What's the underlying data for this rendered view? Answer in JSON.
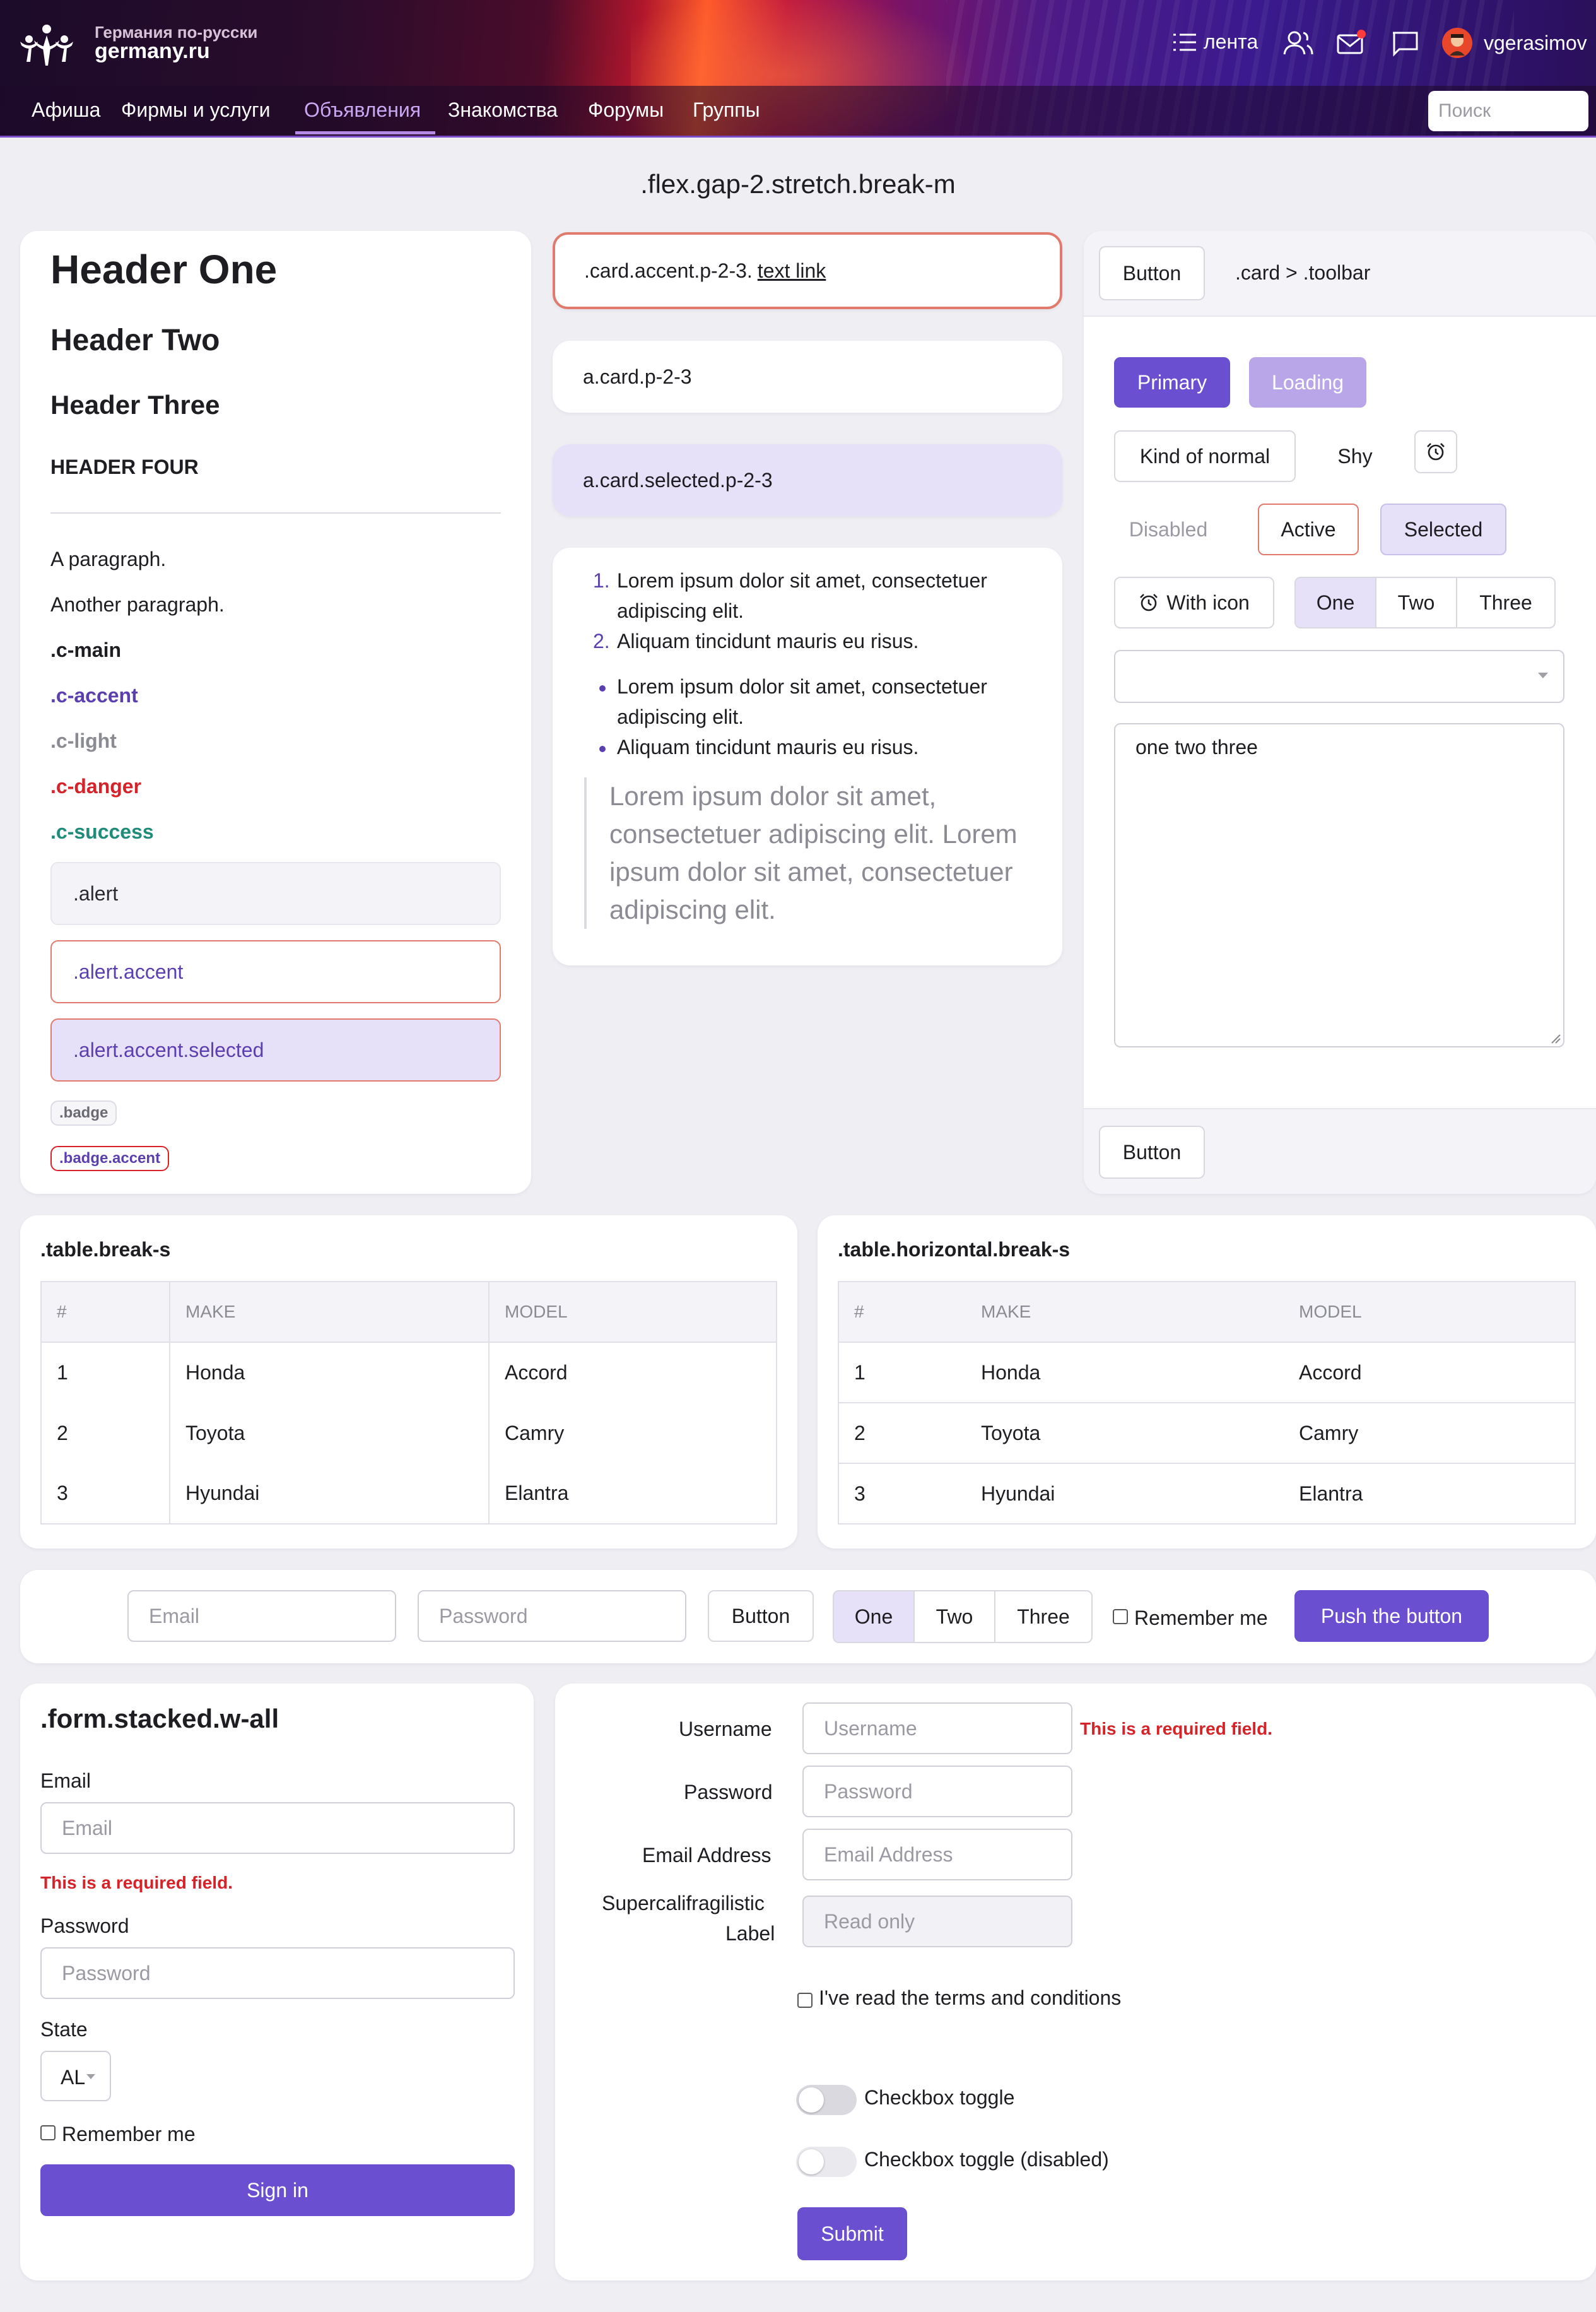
{
  "header": {
    "logo_small": "Германия по-русски",
    "logo_big": "germany.ru",
    "feed": "лента",
    "username": "vgerasimov",
    "search_placeholder": "Поиск",
    "nav": [
      "Афиша",
      "Фирмы и услуги",
      "Объявления",
      "Знакомства",
      "Форумы",
      "Группы"
    ],
    "nav_active": "Объявления",
    "icons": [
      "logo-icon",
      "feed-icon",
      "friends-icon",
      "mail-icon",
      "chat-icon",
      "avatar"
    ]
  },
  "page_title": ".flex.gap-2.stretch.break-m",
  "typography": {
    "h1": "Header One",
    "h2": "Header Two",
    "h3": "Header Three",
    "h4": "HEADER FOUR",
    "p1": "A paragraph.",
    "p2": "Another paragraph.",
    "c_main": ".c-main",
    "c_accent": ".c-accent",
    "c_light": ".c-light",
    "c_danger": ".c-danger",
    "c_success": ".c-success",
    "alert": ".alert",
    "alert_accent": ".alert.accent",
    "alert_accent_selected": ".alert.accent.selected",
    "badge": ".badge",
    "badge_accent": ".badge.accent"
  },
  "middle": {
    "card_accent_prefix": ".card.accent.p-2-3.",
    "card_accent_link": "text link",
    "card_link": "a.card.p-2-3",
    "card_selected": "a.card.selected.p-2-3",
    "ol": [
      "Lorem ipsum dolor sit amet, consectetuer",
      "adipiscing elit.",
      "Aliquam tincidunt mauris eu risus."
    ],
    "ul": [
      "Lorem ipsum dolor sit amet, consectetuer",
      "adipiscing elit.",
      "Aliquam tincidunt mauris eu risus."
    ],
    "quote": [
      "Lorem ipsum dolor sit amet,",
      "consectetuer adipiscing elit. Lorem",
      "ipsum dolor sit amet, consectetuer",
      "adipiscing elit."
    ]
  },
  "toolbar_card": {
    "button": "Button",
    "label": ".card > .toolbar",
    "primary": "Primary",
    "loading": "Loading",
    "kind_of_normal": "Kind of normal",
    "shy": "Shy",
    "disabled": "Disabled",
    "active": "Active",
    "selected": "Selected",
    "with_icon": "With icon",
    "group": [
      "One",
      "Two",
      "Three"
    ],
    "textarea_value": "one two three",
    "footer_button": "Button"
  },
  "tables": [
    {
      "title": ".table.break-s",
      "headers": [
        "#",
        "MAKE",
        "MODEL"
      ],
      "rows": [
        [
          "1",
          "Honda",
          "Accord"
        ],
        [
          "2",
          "Toyota",
          "Camry"
        ],
        [
          "3",
          "Hyundai",
          "Elantra"
        ]
      ]
    },
    {
      "title": ".table.horizontal.break-s",
      "headers": [
        "#",
        "MAKE",
        "MODEL"
      ],
      "rows": [
        [
          "1",
          "Honda",
          "Accord"
        ],
        [
          "2",
          "Toyota",
          "Camry"
        ],
        [
          "3",
          "Hyundai",
          "Elantra"
        ]
      ]
    }
  ],
  "inline_form": {
    "email_placeholder": "Email",
    "password_placeholder": "Password",
    "button": "Button",
    "group": [
      "One",
      "Two",
      "Three"
    ],
    "remember": "Remember me",
    "push": "Push the button"
  },
  "stacked_form": {
    "title": ".form.stacked.w-all",
    "email_label": "Email",
    "email_placeholder": "Email",
    "error": "This is a required field.",
    "password_label": "Password",
    "password_placeholder": "Password",
    "state_label": "State",
    "state_value": "AL",
    "remember": "Remember me",
    "sign_in": "Sign in"
  },
  "horizontal_form": {
    "username_label": "Username",
    "username_placeholder": "Username",
    "error": "This is a required field.",
    "password_label": "Password",
    "password_placeholder": "Password",
    "email_label": "Email Address",
    "email_placeholder": "Email Address",
    "long_label_1": "Supercalifragilistic",
    "long_label_2": "Label",
    "readonly_placeholder": "Read only",
    "terms": "I've read the terms and conditions",
    "toggle": "Checkbox toggle",
    "toggle_disabled": "Checkbox toggle (disabled)",
    "submit": "Submit"
  }
}
